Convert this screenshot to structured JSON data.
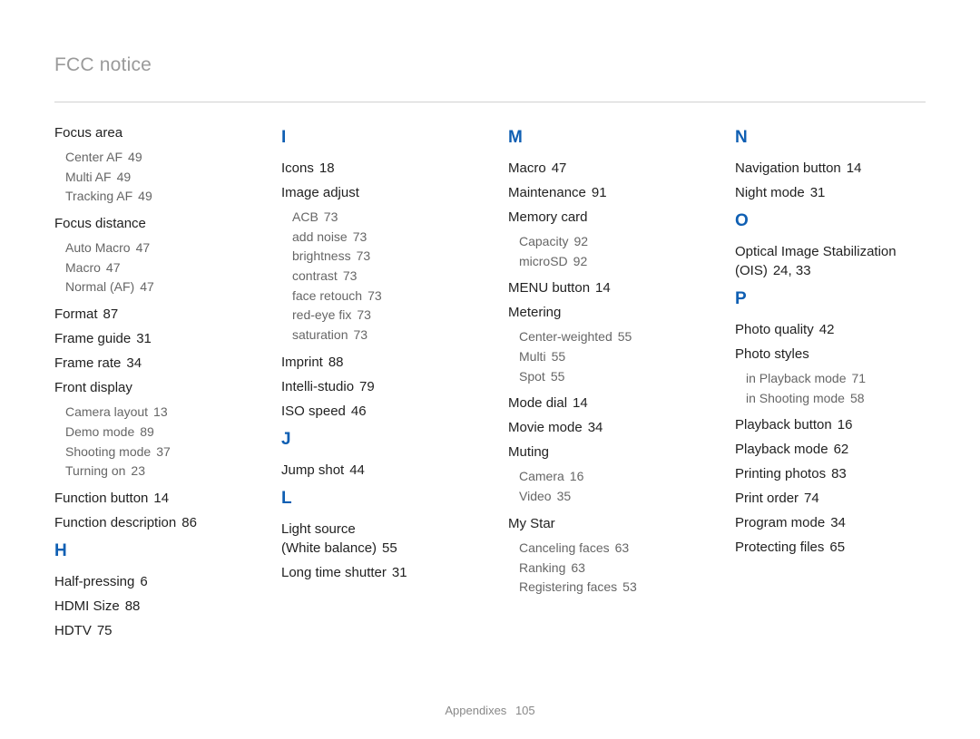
{
  "title": "FCC notice",
  "footer": {
    "section": "Appendixes",
    "page": "105"
  },
  "cols": [
    {
      "groups": [
        {
          "letter": "",
          "entries": [
            {
              "label": "Focus area",
              "page": "",
              "subs": [
                {
                  "label": "Center AF",
                  "page": "49"
                },
                {
                  "label": "Multi AF",
                  "page": "49"
                },
                {
                  "label": "Tracking AF",
                  "page": "49"
                }
              ]
            },
            {
              "label": "Focus distance",
              "page": "",
              "subs": [
                {
                  "label": "Auto Macro",
                  "page": "47"
                },
                {
                  "label": "Macro",
                  "page": "47"
                },
                {
                  "label": "Normal (AF)",
                  "page": "47"
                }
              ]
            },
            {
              "label": "Format",
              "page": "87",
              "subs": []
            },
            {
              "label": "Frame guide",
              "page": "31",
              "subs": []
            },
            {
              "label": "Frame rate",
              "page": "34",
              "subs": []
            },
            {
              "label": "Front display",
              "page": "",
              "subs": [
                {
                  "label": "Camera layout",
                  "page": "13"
                },
                {
                  "label": "Demo mode",
                  "page": "89"
                },
                {
                  "label": "Shooting mode",
                  "page": "37"
                },
                {
                  "label": "Turning on",
                  "page": "23"
                }
              ]
            },
            {
              "label": "Function button",
              "page": "14",
              "subs": []
            },
            {
              "label": "Function description",
              "page": "86",
              "subs": []
            }
          ]
        },
        {
          "letter": "H",
          "entries": [
            {
              "label": "Half-pressing",
              "page": "6",
              "subs": []
            },
            {
              "label": "HDMI Size",
              "page": "88",
              "subs": []
            },
            {
              "label": "HDTV",
              "page": "75",
              "subs": []
            }
          ]
        }
      ]
    },
    {
      "groups": [
        {
          "letter": "I",
          "entries": [
            {
              "label": "Icons",
              "page": "18",
              "subs": []
            },
            {
              "label": "Image adjust",
              "page": "",
              "subs": [
                {
                  "label": "ACB",
                  "page": "73"
                },
                {
                  "label": "add noise",
                  "page": "73"
                },
                {
                  "label": "brightness",
                  "page": "73"
                },
                {
                  "label": "contrast",
                  "page": "73"
                },
                {
                  "label": "face retouch",
                  "page": "73"
                },
                {
                  "label": "red-eye fix",
                  "page": "73"
                },
                {
                  "label": "saturation",
                  "page": "73"
                }
              ]
            },
            {
              "label": "Imprint",
              "page": "88",
              "subs": []
            },
            {
              "label": "Intelli-studio",
              "page": "79",
              "subs": []
            },
            {
              "label": "ISO speed",
              "page": "46",
              "subs": []
            }
          ]
        },
        {
          "letter": "J",
          "entries": [
            {
              "label": "Jump shot",
              "page": "44",
              "subs": []
            }
          ]
        },
        {
          "letter": "L",
          "entries": [
            {
              "label": "Light source\n(White balance)",
              "page": "55",
              "subs": []
            },
            {
              "label": "Long time shutter",
              "page": "31",
              "subs": []
            }
          ]
        }
      ]
    },
    {
      "groups": [
        {
          "letter": "M",
          "entries": [
            {
              "label": "Macro",
              "page": "47",
              "subs": []
            },
            {
              "label": "Maintenance",
              "page": "91",
              "subs": []
            },
            {
              "label": "Memory card",
              "page": "",
              "subs": [
                {
                  "label": "Capacity",
                  "page": "92"
                },
                {
                  "label": "microSD",
                  "page": "92"
                }
              ]
            },
            {
              "label": "MENU button",
              "page": "14",
              "subs": []
            },
            {
              "label": "Metering",
              "page": "",
              "subs": [
                {
                  "label": "Center-weighted",
                  "page": "55"
                },
                {
                  "label": "Multi",
                  "page": "55"
                },
                {
                  "label": "Spot",
                  "page": "55"
                }
              ]
            },
            {
              "label": "Mode dial",
              "page": "14",
              "subs": []
            },
            {
              "label": "Movie mode",
              "page": "34",
              "subs": []
            },
            {
              "label": "Muting",
              "page": "",
              "subs": [
                {
                  "label": "Camera",
                  "page": "16"
                },
                {
                  "label": "Video",
                  "page": "35"
                }
              ]
            },
            {
              "label": "My Star",
              "page": "",
              "subs": [
                {
                  "label": "Canceling faces",
                  "page": "63"
                },
                {
                  "label": "Ranking",
                  "page": "63"
                },
                {
                  "label": "Registering faces",
                  "page": "53"
                }
              ]
            }
          ]
        }
      ]
    },
    {
      "groups": [
        {
          "letter": "N",
          "entries": [
            {
              "label": "Navigation button",
              "page": "14",
              "subs": []
            },
            {
              "label": "Night mode",
              "page": "31",
              "subs": []
            }
          ]
        },
        {
          "letter": "O",
          "entries": [
            {
              "label": "Optical Image Stabilization (OIS)",
              "page": "24, 33",
              "subs": []
            }
          ]
        },
        {
          "letter": "P",
          "entries": [
            {
              "label": "Photo quality",
              "page": "42",
              "subs": []
            },
            {
              "label": "Photo styles",
              "page": "",
              "subs": [
                {
                  "label": "in Playback mode",
                  "page": "71"
                },
                {
                  "label": "in Shooting mode",
                  "page": "58"
                }
              ]
            },
            {
              "label": "Playback button",
              "page": "16",
              "subs": []
            },
            {
              "label": "Playback mode",
              "page": "62",
              "subs": []
            },
            {
              "label": "Printing photos",
              "page": "83",
              "subs": []
            },
            {
              "label": "Print order",
              "page": "74",
              "subs": []
            },
            {
              "label": "Program mode",
              "page": "34",
              "subs": []
            },
            {
              "label": "Protecting files",
              "page": "65",
              "subs": []
            }
          ]
        }
      ]
    }
  ]
}
